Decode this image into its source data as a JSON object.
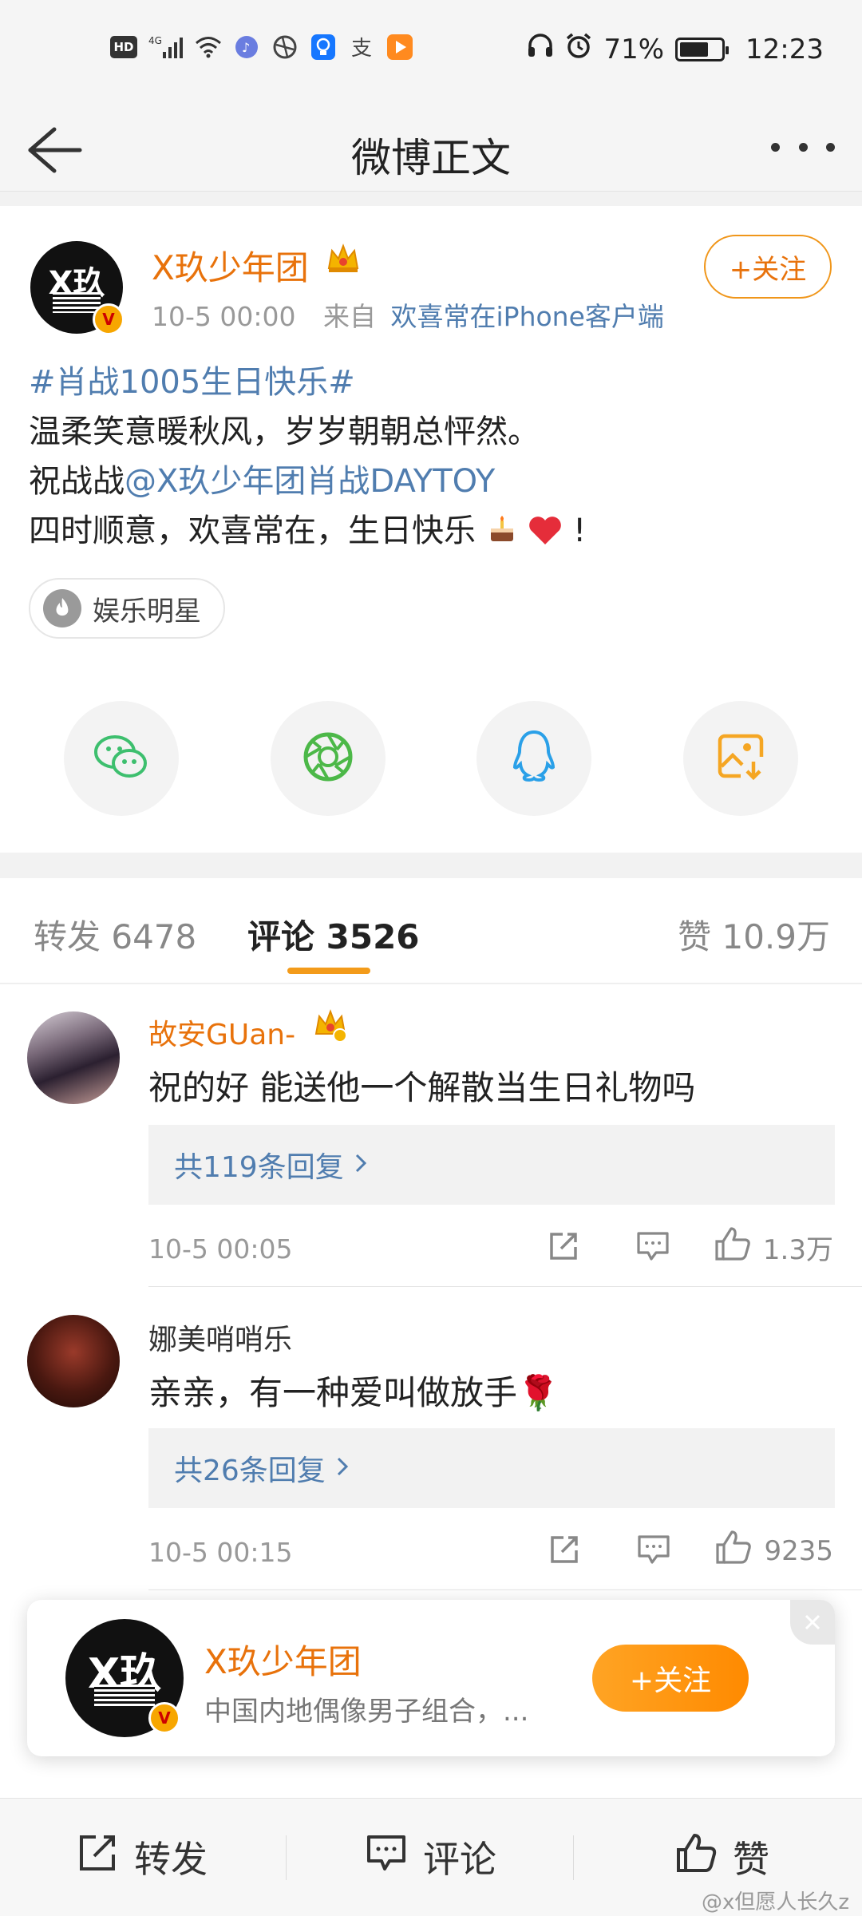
{
  "status_bar": {
    "hd": "HD",
    "network": "4G",
    "battery_level": 0.71,
    "battery_text": "71%",
    "time": "12:23"
  },
  "nav": {
    "title": "微博正文"
  },
  "post": {
    "author": "X玖少年团",
    "avatar_text": "X玖",
    "verified_mark": "V",
    "time": "10-5 00:00",
    "source_prefix": "来自",
    "source": "欢喜常在iPhone客户端",
    "follow_label": "+关注",
    "hashtag": "#肖战1005生日快乐#",
    "line1": "温柔笑意暖秋风，岁岁朝朝总怦然。",
    "line2_prefix": "祝战战",
    "mention": "@X玖少年团肖战DAYTOY",
    "line3": "四时顺意，欢喜常在，生日快乐",
    "line3_suffix": "!",
    "topic_chip": "娱乐明星"
  },
  "tabs": {
    "repost": "转发 6478",
    "comment": "评论 3526",
    "like": "赞 10.9万"
  },
  "comments": [
    {
      "user": "故安GUan-",
      "text": "祝的好 能送他一个解散当生日礼物吗",
      "replies": "共119条回复",
      "time": "10-5 00:05",
      "likes": "1.3万",
      "name_color": "#e8720b"
    },
    {
      "user": "娜美哨哨乐",
      "text": "亲亲，有一种爱叫做放手🌹",
      "replies": "共26条回复",
      "time": "10-5 00:15",
      "likes": "9235",
      "name_color": "#333333"
    }
  ],
  "popup": {
    "name": "X玖少年团",
    "avatar_text": "X玖",
    "description": "中国内地偶像男子组合，...",
    "follow_label": "+关注"
  },
  "bottom_bar": {
    "repost": "转发",
    "comment": "评论",
    "like": "赞"
  },
  "watermark": "@x但愿人长久z",
  "colors": {
    "accent_orange": "#e8720b",
    "link_blue": "#507daf"
  }
}
